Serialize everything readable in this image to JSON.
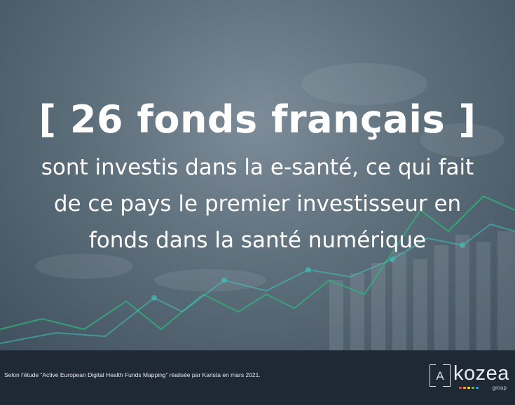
{
  "headline": {
    "title": "[ 26 fonds français ]",
    "line1": "sont investis dans la e-santé, ce qui fait",
    "line2": "de ce pays le premier investisseur en",
    "line3": "fonds dans la santé numérique"
  },
  "footer": {
    "source": "Selon l’étude “Active European Digital Health Funds Mapping” réalisée par Karista en mars 2021.",
    "logo_bracket_letter": "A",
    "logo_word": "kozea",
    "logo_group": "group"
  },
  "colors": {
    "footer_bg": "#1e2935",
    "chart_line_green": "#2fb77a",
    "chart_line_teal": "#3fc6c0",
    "logo_dots": [
      "#e94b3c",
      "#f1a33b",
      "#f6d24a",
      "#5bb96a",
      "#3c8dd6"
    ]
  }
}
